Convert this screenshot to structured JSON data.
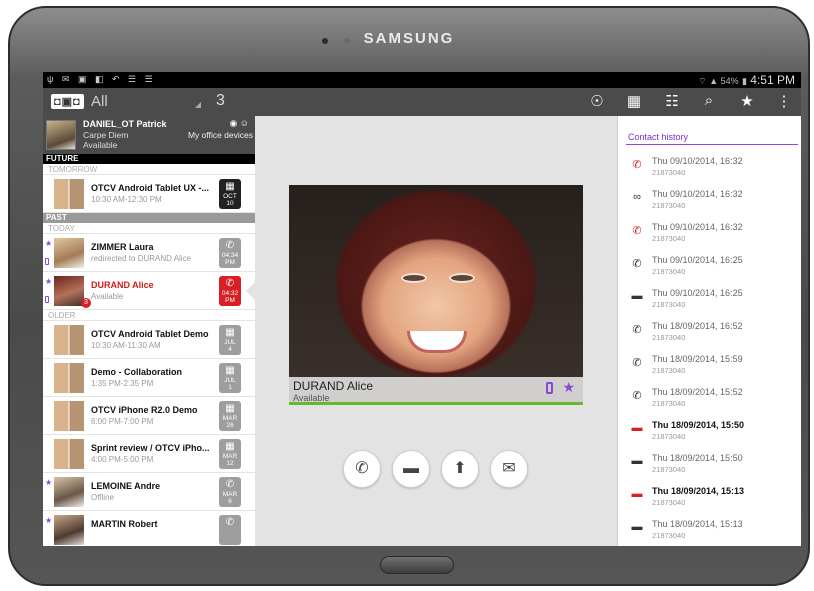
{
  "device": {
    "brand": "SAMSUNG"
  },
  "status_bar": {
    "battery": "54%",
    "time": "4:51 PM",
    "left_icons": "ψ ✉ ▣ ◧ ↶ ☰ ☰"
  },
  "action_bar": {
    "logo": "◘▣◘",
    "filter": "All",
    "count": "3"
  },
  "user": {
    "name": "DANIEL_OT Patrick",
    "mood": "Carpe Diem",
    "status": "Available",
    "devices_label": "My office devices"
  },
  "sections": {
    "future": "FUTURE",
    "tomorrow": "TOMORROW",
    "past": "PAST",
    "today": "TODAY",
    "older": "OLDER"
  },
  "items": [
    {
      "title": "OTCV Android Tablet UX -...",
      "sub": "10:30 AM-12:30 PM",
      "badge_l1": "OCT",
      "badge_l2": "10"
    },
    {
      "title": "ZIMMER Laura",
      "sub": "redirected to DURAND Alice",
      "badge_l1": "04:34",
      "badge_l2": "PM"
    },
    {
      "title": "DURAND Alice",
      "sub": "Available",
      "badge_l1": "04:32",
      "badge_l2": "PM",
      "unread": "3"
    },
    {
      "title": "OTCV Android Tablet Demo",
      "sub": "10:30 AM-11:30 AM",
      "badge_l1": "JUL",
      "badge_l2": "4"
    },
    {
      "title": "Demo - Collaboration",
      "sub": "1:35 PM-2:35 PM",
      "badge_l1": "JUL",
      "badge_l2": "1"
    },
    {
      "title": "OTCV iPhone R2.0 Demo",
      "sub": "6:00 PM-7:00 PM",
      "badge_l1": "MAR",
      "badge_l2": "26"
    },
    {
      "title": "Sprint review / OTCV iPho...",
      "sub": "4:00 PM-5:00 PM",
      "badge_l1": "MAR",
      "badge_l2": "12"
    },
    {
      "title": "LEMOINE Andre",
      "sub": "Offline",
      "badge_l1": "MAR",
      "badge_l2": "6"
    },
    {
      "title": "MARTIN Robert",
      "sub": "",
      "badge_l1": "",
      "badge_l2": ""
    }
  ],
  "contact": {
    "name": "DURAND Alice",
    "status": "Available"
  },
  "history": {
    "title": "Contact history",
    "entries": [
      {
        "date": "Thu 09/10/2014, 16:32",
        "number": "21873040",
        "icon": "missed-call-icon"
      },
      {
        "date": "Thu 09/10/2014, 16:32",
        "number": "21873040",
        "icon": "voicemail-icon"
      },
      {
        "date": "Thu 09/10/2014, 16:32",
        "number": "21873040",
        "icon": "missed-call-icon"
      },
      {
        "date": "Thu 09/10/2014, 16:25",
        "number": "21873040",
        "icon": "call-icon"
      },
      {
        "date": "Thu 09/10/2014, 16:25",
        "number": "21873040",
        "icon": "message-icon"
      },
      {
        "date": "Thu 18/09/2014, 16:52",
        "number": "21873040",
        "icon": "outgoing-call-icon"
      },
      {
        "date": "Thu 18/09/2014, 15:59",
        "number": "21873040",
        "icon": "outgoing-call-icon"
      },
      {
        "date": "Thu 18/09/2014, 15:52",
        "number": "21873040",
        "icon": "outgoing-call-icon"
      },
      {
        "date": "Thu 18/09/2014, 15:50",
        "number": "21873040",
        "icon": "unread-message-icon"
      },
      {
        "date": "Thu 18/09/2014, 15:50",
        "number": "21873040",
        "icon": "message-icon"
      },
      {
        "date": "Thu 18/09/2014, 15:13",
        "number": "21873040",
        "icon": "unread-message-icon"
      },
      {
        "date": "Thu 18/09/2014, 15:13",
        "number": "21873040",
        "icon": "message-icon"
      }
    ]
  },
  "colors": {
    "accent": "#8a48d4",
    "alert": "#d71f26",
    "available": "#66b82c",
    "actionbar": "#4b4b4b"
  }
}
